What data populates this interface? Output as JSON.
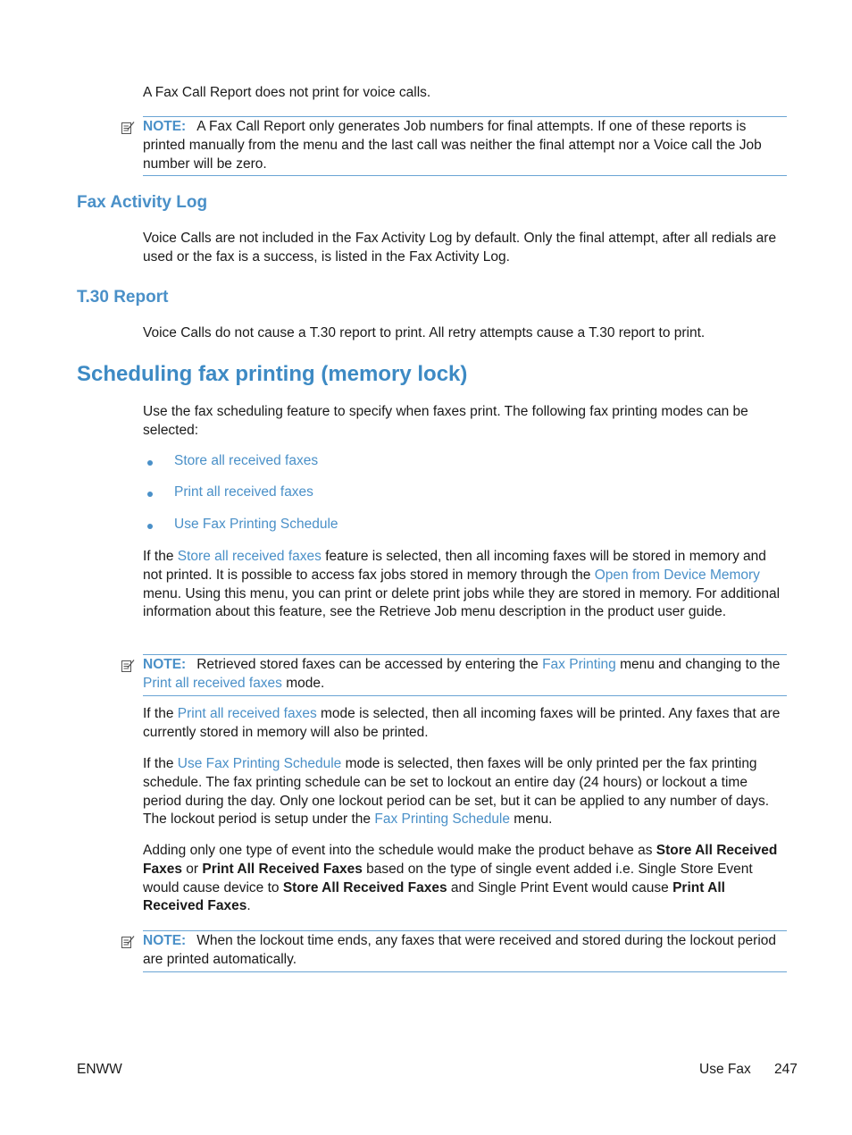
{
  "intro_line": "A Fax Call Report does not print for voice calls.",
  "note1": {
    "label": "NOTE:",
    "text": "A Fax Call Report only generates Job numbers for final attempts. If one of these reports is printed manually from the menu and the last call was neither the final attempt nor a Voice call the Job number will be zero."
  },
  "section_fax_activity_log": {
    "heading": "Fax Activity Log",
    "text": "Voice Calls are not included in the Fax Activity Log by default. Only the final attempt, after all redials are used or the fax is a success, is listed in the Fax Activity Log."
  },
  "section_t30": {
    "heading": "T.30 Report",
    "text": "Voice Calls do not cause a T.30 report to print. All retry attempts cause a T.30 report to print."
  },
  "section_scheduling": {
    "heading": "Scheduling fax printing (memory lock)",
    "intro": "Use the fax scheduling feature to specify when faxes print. The following fax printing modes can be selected:",
    "modes": [
      "Store all received faxes",
      "Print all received faxes",
      "Use Fax Printing Schedule"
    ],
    "para_store": {
      "t1": "If the ",
      "link1": "Store all received faxes",
      "t2": " feature is selected, then all incoming faxes will be stored in memory and not printed. It is possible to access fax jobs stored in memory through the ",
      "link2": "Open from Device Memory",
      "t3": " menu. Using this menu, you can print or delete print jobs while they are stored in memory. For additional information about this feature, see the Retrieve Job menu description in the product user guide."
    },
    "note2": {
      "label": "NOTE:",
      "t1": "Retrieved stored faxes can be accessed by entering the ",
      "link1": "Fax Printing",
      "t2": " menu and changing to the ",
      "link2": "Print all received faxes",
      "t3": " mode."
    },
    "para_print": {
      "t1": "If the ",
      "link1": "Print all received faxes",
      "t2": " mode is selected, then all incoming faxes will be printed. Any faxes that are currently stored in memory will also be printed."
    },
    "para_schedule": {
      "t1": "If the ",
      "link1": "Use Fax Printing Schedule",
      "t2": " mode is selected, then faxes will be only printed per the fax printing schedule. The fax printing schedule can be set to lockout an entire day (24 hours) or lockout a time period during the day. Only one lockout period can be set, but it can be applied to any number of days. The lockout period is setup under the ",
      "link2": "Fax Printing Schedule",
      "t3": " menu."
    },
    "para_adding": {
      "t1": "Adding only one type of event into the schedule would make the product behave as ",
      "b1": "Store All Received Faxes",
      "t2": " or ",
      "b2": "Print All Received Faxes",
      "t3": " based on the type of single event added i.e. Single Store Event would cause device to ",
      "b3": "Store All Received Faxes",
      "t4": " and Single Print Event would cause ",
      "b4": "Print All Received Faxes",
      "t5": "."
    },
    "note3": {
      "label": "NOTE:",
      "text": "When the lockout time ends, any faxes that were received and stored during the lockout period are printed automatically."
    }
  },
  "footer": {
    "left": "ENWW",
    "section": "Use Fax",
    "page_number": "247"
  }
}
